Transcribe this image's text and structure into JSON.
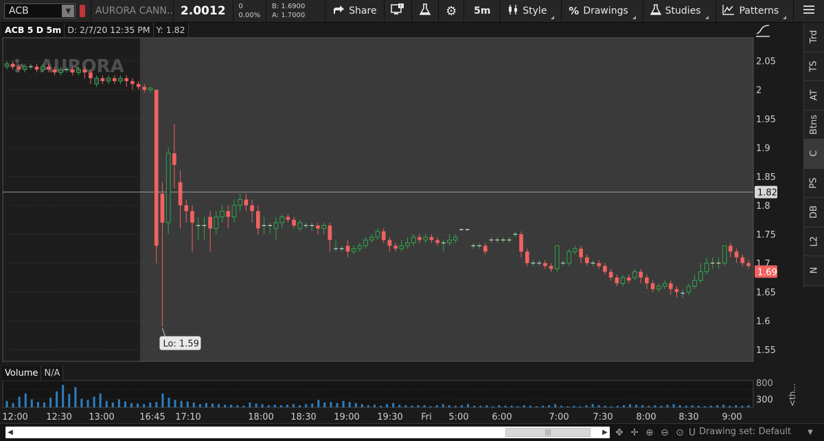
{
  "toolbar": {
    "symbol": "ACB",
    "company": "AURORA CANN...",
    "last": "2.0012",
    "change": "0",
    "change_pct": "0.00%",
    "bid": "B: 1.6900",
    "ask": "A: 1.7000",
    "share_label": "Share",
    "timeframe": "5m",
    "style_label": "Style",
    "drawings_label": "Drawings",
    "studies_label": "Studies",
    "patterns_label": "Patterns"
  },
  "infobar": {
    "title": "ACB 5 D 5m",
    "date": "D: 2/7/20 12:35 PM",
    "y": "Y: 1.82"
  },
  "watermark": "AURORA",
  "volume": {
    "label": "Volume",
    "value": "N/A"
  },
  "right_tabs": [
    "Trd",
    "TS",
    "AT",
    "Btns",
    "C",
    "PS",
    "DB",
    "L2",
    "N"
  ],
  "right_tabs_active": 4,
  "right_bottom": "<th...",
  "bottom": {
    "drawing_set": "Drawing set: Default"
  },
  "colors": {
    "up": "#2fa84f",
    "down": "#f0625f",
    "cursor_tag": "#d8d8d8",
    "price_tag": "#f0625f"
  },
  "chart_data": {
    "type": "candlestick",
    "y_ticks": [
      "2.05",
      "2",
      "1.95",
      "1.9",
      "1.85",
      "1.8",
      "1.75",
      "1.7",
      "1.65",
      "1.6",
      "1.55"
    ],
    "y_tick_values": [
      2.05,
      2.0,
      1.95,
      1.9,
      1.85,
      1.8,
      1.75,
      1.7,
      1.65,
      1.6,
      1.55
    ],
    "ylim": [
      1.53,
      2.09
    ],
    "x_labels": [
      "12:00",
      "12:30",
      "13:00",
      "16:45",
      "17:10",
      "18:00",
      "18:30",
      "19:00",
      "19:30",
      "Fri",
      "5:00",
      "6:00",
      "7:00",
      "7:30",
      "8:00",
      "8:30",
      "9:00"
    ],
    "cursor_price": "1.82",
    "cursor_value": 1.823,
    "last_price": "1.69",
    "last_value": 1.69,
    "low_label": "Lo: 1.59",
    "low_value": 1.59,
    "volume_ticks": [
      "800",
      "300"
    ],
    "candles": [
      [
        2.04,
        2.045,
        2.05,
        2.035
      ],
      [
        2.045,
        2.04,
        2.05,
        2.035
      ],
      [
        2.04,
        2.035,
        2.045,
        2.03
      ],
      [
        2.035,
        2.04,
        2.045,
        2.03
      ],
      [
        2.04,
        2.04,
        2.045,
        2.035
      ],
      [
        2.04,
        2.035,
        2.045,
        2.03
      ],
      [
        2.035,
        2.04,
        2.045,
        2.03
      ],
      [
        2.04,
        2.035,
        2.045,
        2.03
      ],
      [
        2.035,
        2.03,
        2.04,
        2.025
      ],
      [
        2.03,
        2.035,
        2.04,
        2.025
      ],
      [
        2.035,
        2.035,
        2.04,
        2.03
      ],
      [
        2.035,
        2.03,
        2.04,
        2.025
      ],
      [
        2.03,
        2.035,
        2.04,
        2.025
      ],
      [
        2.035,
        2.03,
        2.04,
        2.02
      ],
      [
        2.03,
        2.02,
        2.035,
        2.01
      ],
      [
        2.01,
        2.02,
        2.025,
        2.005
      ],
      [
        2.02,
        2.015,
        2.025,
        2.01
      ],
      [
        2.015,
        2.02,
        2.025,
        2.01
      ],
      [
        2.02,
        2.015,
        2.025,
        2.01
      ],
      [
        2.015,
        2.02,
        2.025,
        2.01
      ],
      [
        2.02,
        2.015,
        2.025,
        2.005
      ],
      [
        2.015,
        2.01,
        2.02,
        2.0
      ],
      [
        2.01,
        2.005,
        2.015,
        2.0
      ],
      [
        2.005,
        2.0,
        2.01,
        1.995
      ],
      [
        2.0,
        2.003,
        2.005,
        1.995
      ],
      [
        2.0,
        1.73,
        2.0,
        1.7
      ],
      [
        1.82,
        1.77,
        1.84,
        1.59
      ],
      [
        1.77,
        1.89,
        1.9,
        1.75
      ],
      [
        1.89,
        1.87,
        1.94,
        1.83
      ],
      [
        1.84,
        1.8,
        1.86,
        1.76
      ],
      [
        1.8,
        1.79,
        1.81,
        1.77
      ],
      [
        1.79,
        1.77,
        1.8,
        1.72
      ],
      [
        1.765,
        1.765,
        1.78,
        1.74
      ],
      [
        1.765,
        1.765,
        1.78,
        1.74
      ],
      [
        1.78,
        1.76,
        1.79,
        1.72
      ],
      [
        1.76,
        1.78,
        1.79,
        1.75
      ],
      [
        1.78,
        1.79,
        1.8,
        1.77
      ],
      [
        1.79,
        1.78,
        1.8,
        1.76
      ],
      [
        1.78,
        1.8,
        1.81,
        1.77
      ],
      [
        1.8,
        1.81,
        1.82,
        1.79
      ],
      [
        1.81,
        1.8,
        1.82,
        1.79
      ],
      [
        1.8,
        1.79,
        1.81,
        1.77
      ],
      [
        1.79,
        1.76,
        1.8,
        1.75
      ],
      [
        1.765,
        1.765,
        1.78,
        1.75
      ],
      [
        1.765,
        1.765,
        1.77,
        1.75
      ],
      [
        1.76,
        1.77,
        1.78,
        1.74
      ],
      [
        1.77,
        1.78,
        1.785,
        1.76
      ],
      [
        1.78,
        1.775,
        1.785,
        1.77
      ],
      [
        1.775,
        1.765,
        1.78,
        1.76
      ],
      [
        1.76,
        1.77,
        1.775,
        1.755
      ],
      [
        1.765,
        1.765,
        1.77,
        1.76
      ],
      [
        1.765,
        1.765,
        1.77,
        1.755
      ],
      [
        1.765,
        1.76,
        1.77,
        1.75
      ],
      [
        1.76,
        1.765,
        1.77,
        1.75
      ],
      [
        1.765,
        1.74,
        1.77,
        1.72
      ],
      [
        1.725,
        1.725,
        1.74,
        1.72
      ],
      [
        1.725,
        1.725,
        1.73,
        1.72
      ],
      [
        1.73,
        1.72,
        1.74,
        1.71
      ],
      [
        1.72,
        1.725,
        1.73,
        1.715
      ],
      [
        1.725,
        1.73,
        1.735,
        1.72
      ],
      [
        1.73,
        1.74,
        1.745,
        1.725
      ],
      [
        1.74,
        1.745,
        1.75,
        1.735
      ],
      [
        1.745,
        1.755,
        1.76,
        1.74
      ],
      [
        1.755,
        1.74,
        1.76,
        1.735
      ],
      [
        1.74,
        1.73,
        1.745,
        1.72
      ],
      [
        1.73,
        1.725,
        1.735,
        1.72
      ],
      [
        1.725,
        1.73,
        1.74,
        1.72
      ],
      [
        1.73,
        1.735,
        1.745,
        1.725
      ],
      [
        1.735,
        1.745,
        1.75,
        1.73
      ],
      [
        1.745,
        1.74,
        1.75,
        1.735
      ],
      [
        1.74,
        1.745,
        1.75,
        1.735
      ],
      [
        1.745,
        1.74,
        1.75,
        1.735
      ],
      [
        1.74,
        1.735,
        1.745,
        1.73
      ],
      [
        1.735,
        1.735,
        1.74,
        1.72
      ],
      [
        1.735,
        1.74,
        1.75,
        1.73
      ],
      [
        1.74,
        1.745,
        1.75,
        1.735
      ],
      [
        1.758,
        1.758,
        1.76,
        1.755
      ],
      [
        1.758,
        1.758,
        1.76,
        1.755
      ],
      [
        1.73,
        1.73,
        1.735,
        1.725
      ],
      [
        1.73,
        1.73,
        1.735,
        1.725
      ],
      [
        1.73,
        1.72,
        1.735,
        1.715
      ],
      [
        1.74,
        1.74,
        1.745,
        1.735
      ],
      [
        1.74,
        1.74,
        1.745,
        1.735
      ],
      [
        1.74,
        1.74,
        1.745,
        1.735
      ],
      [
        1.74,
        1.74,
        1.745,
        1.735
      ],
      [
        1.75,
        1.75,
        1.755,
        1.745
      ],
      [
        1.75,
        1.72,
        1.755,
        1.71
      ],
      [
        1.72,
        1.7,
        1.725,
        1.695
      ],
      [
        1.7,
        1.7,
        1.705,
        1.695
      ],
      [
        1.7,
        1.7,
        1.705,
        1.695
      ],
      [
        1.7,
        1.695,
        1.705,
        1.69
      ],
      [
        1.695,
        1.69,
        1.7,
        1.685
      ],
      [
        1.69,
        1.73,
        1.73,
        1.685
      ],
      [
        1.7,
        1.7,
        1.705,
        1.695
      ],
      [
        1.7,
        1.72,
        1.725,
        1.695
      ],
      [
        1.72,
        1.725,
        1.73,
        1.715
      ],
      [
        1.725,
        1.71,
        1.73,
        1.7
      ],
      [
        1.71,
        1.7,
        1.715,
        1.695
      ],
      [
        1.7,
        1.7,
        1.705,
        1.695
      ],
      [
        1.7,
        1.695,
        1.705,
        1.69
      ],
      [
        1.695,
        1.685,
        1.7,
        1.68
      ],
      [
        1.685,
        1.675,
        1.69,
        1.67
      ],
      [
        1.675,
        1.665,
        1.68,
        1.66
      ],
      [
        1.665,
        1.675,
        1.68,
        1.66
      ],
      [
        1.675,
        1.67,
        1.68,
        1.665
      ],
      [
        1.675,
        1.685,
        1.69,
        1.67
      ],
      [
        1.685,
        1.675,
        1.69,
        1.665
      ],
      [
        1.675,
        1.665,
        1.68,
        1.655
      ],
      [
        1.665,
        1.655,
        1.67,
        1.65
      ],
      [
        1.655,
        1.66,
        1.665,
        1.65
      ],
      [
        1.66,
        1.665,
        1.67,
        1.655
      ],
      [
        1.665,
        1.655,
        1.67,
        1.645
      ],
      [
        1.655,
        1.65,
        1.66,
        1.64
      ],
      [
        1.648,
        1.648,
        1.655,
        1.64
      ],
      [
        1.65,
        1.66,
        1.665,
        1.645
      ],
      [
        1.66,
        1.67,
        1.68,
        1.655
      ],
      [
        1.67,
        1.685,
        1.7,
        1.665
      ],
      [
        1.685,
        1.7,
        1.71,
        1.68
      ],
      [
        1.7,
        1.7,
        1.71,
        1.69
      ],
      [
        1.7,
        1.7,
        1.71,
        1.69
      ],
      [
        1.7,
        1.73,
        1.73,
        1.695
      ],
      [
        1.73,
        1.72,
        1.735,
        1.71
      ],
      [
        1.72,
        1.71,
        1.725,
        1.7
      ],
      [
        1.71,
        1.7,
        1.715,
        1.695
      ],
      [
        1.7,
        1.695,
        1.705,
        1.69
      ]
    ],
    "volumes": [
      120,
      80,
      200,
      260,
      150,
      100,
      90,
      180,
      300,
      420,
      250,
      380,
      160,
      140,
      200,
      260,
      120,
      90,
      150,
      110,
      80,
      70,
      60,
      90,
      100,
      260,
      180,
      140,
      120,
      110,
      90,
      60,
      80,
      70,
      60,
      50,
      50,
      40,
      30,
      90,
      70,
      60,
      40,
      50,
      40,
      50,
      60,
      40,
      60,
      70,
      140,
      90,
      100,
      80,
      120,
      100,
      80,
      60,
      40,
      50,
      30,
      60,
      80,
      50,
      40,
      30,
      40,
      40,
      20,
      40,
      60,
      40,
      30,
      40,
      60,
      30,
      30,
      40,
      20,
      40,
      30,
      30,
      20,
      40,
      30,
      20,
      30,
      40,
      60,
      30,
      20,
      30,
      20,
      40,
      60,
      40,
      30,
      20,
      30,
      40,
      60,
      50,
      40,
      30,
      40,
      30,
      50,
      60,
      40,
      30,
      40,
      30,
      20,
      30,
      40,
      50,
      30,
      40,
      30,
      40
    ]
  }
}
